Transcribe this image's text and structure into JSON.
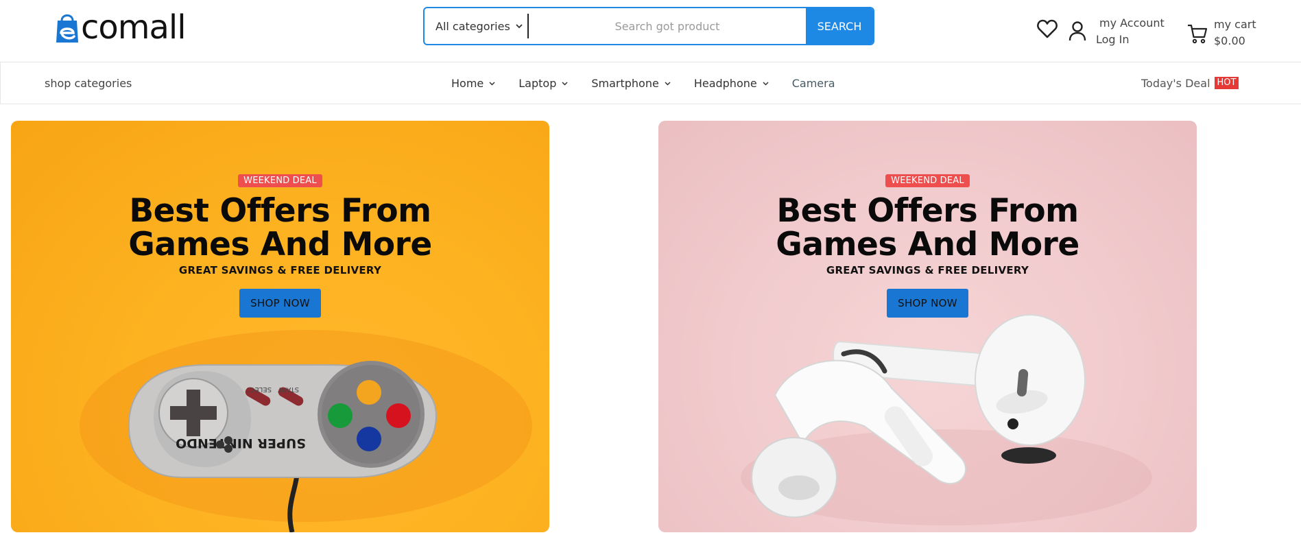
{
  "header": {
    "logo_text": "comall",
    "logo_lettering": "e",
    "search": {
      "category_label": "All categories",
      "placeholder": "Search got product",
      "button_label": "SEARCH"
    },
    "account": {
      "line1": "my Account",
      "line2": "Log In"
    },
    "cart": {
      "line1": "my cart",
      "line2": "$0.00"
    }
  },
  "nav": {
    "shop_categories": "shop categories",
    "items": [
      {
        "label": "Home",
        "has_dropdown": true
      },
      {
        "label": "Laptop",
        "has_dropdown": true
      },
      {
        "label": "Smartphone",
        "has_dropdown": true
      },
      {
        "label": "Headphone",
        "has_dropdown": true
      },
      {
        "label": "Camera",
        "has_dropdown": false
      }
    ],
    "deal_label": "Today's Deal",
    "deal_badge": "HOT"
  },
  "banners": [
    {
      "tag": "WEEKEND DEAL",
      "title_line1": "Best Offers From",
      "title_line2": "Games And More",
      "subtitle": "GREAT SAVINGS & FREE DELIVERY",
      "button_label": "SHOP NOW",
      "background": "#fdb221",
      "image": "game-controller"
    },
    {
      "tag": "WEEKEND DEAL",
      "title_line1": "Best Offers From",
      "title_line2": "Games And More",
      "subtitle": "GREAT SAVINGS & FREE DELIVERY",
      "button_label": "SHOP NOW",
      "background": "#f1cbcd",
      "image": "wireless-earbuds"
    }
  ],
  "colors": {
    "accent": "#1e88e5",
    "tag": "#ef4e4e",
    "hot": "#e53935"
  }
}
